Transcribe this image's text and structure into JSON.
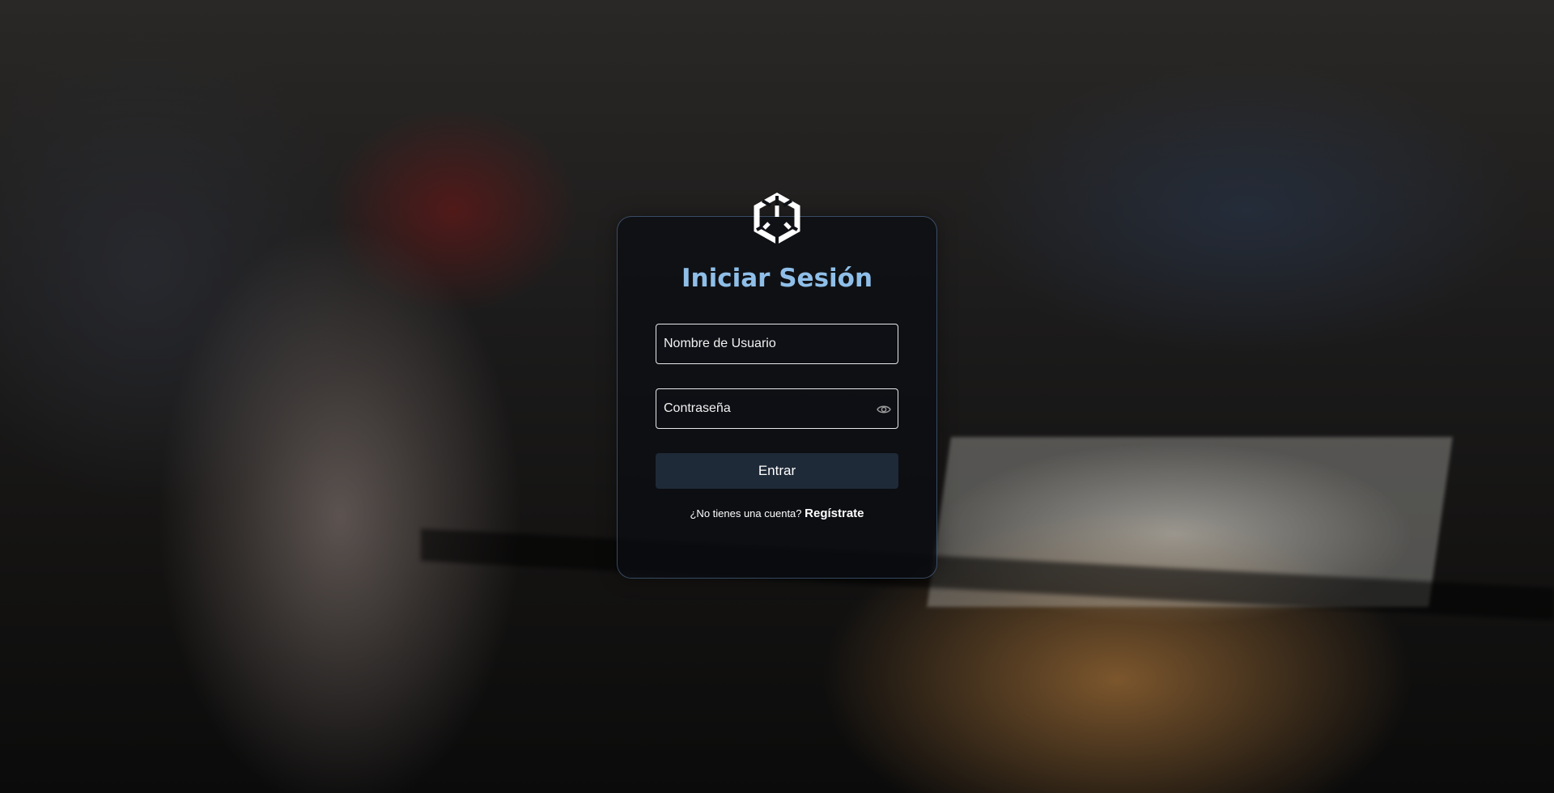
{
  "page": {
    "logo_icon": "hexagon-cube-logo",
    "title": "Iniciar Sesión"
  },
  "form": {
    "username_placeholder": "Nombre de Usuario",
    "password_placeholder": "Contraseña",
    "password_toggle_icon": "eye-icon",
    "submit_label": "Entrar"
  },
  "register": {
    "prompt": "¿No tienes una cuenta?",
    "link_label": "Regístrate"
  },
  "colors": {
    "title": "#8fbfe8",
    "button": "#1f2a38",
    "card_border": "#6e96c8"
  }
}
